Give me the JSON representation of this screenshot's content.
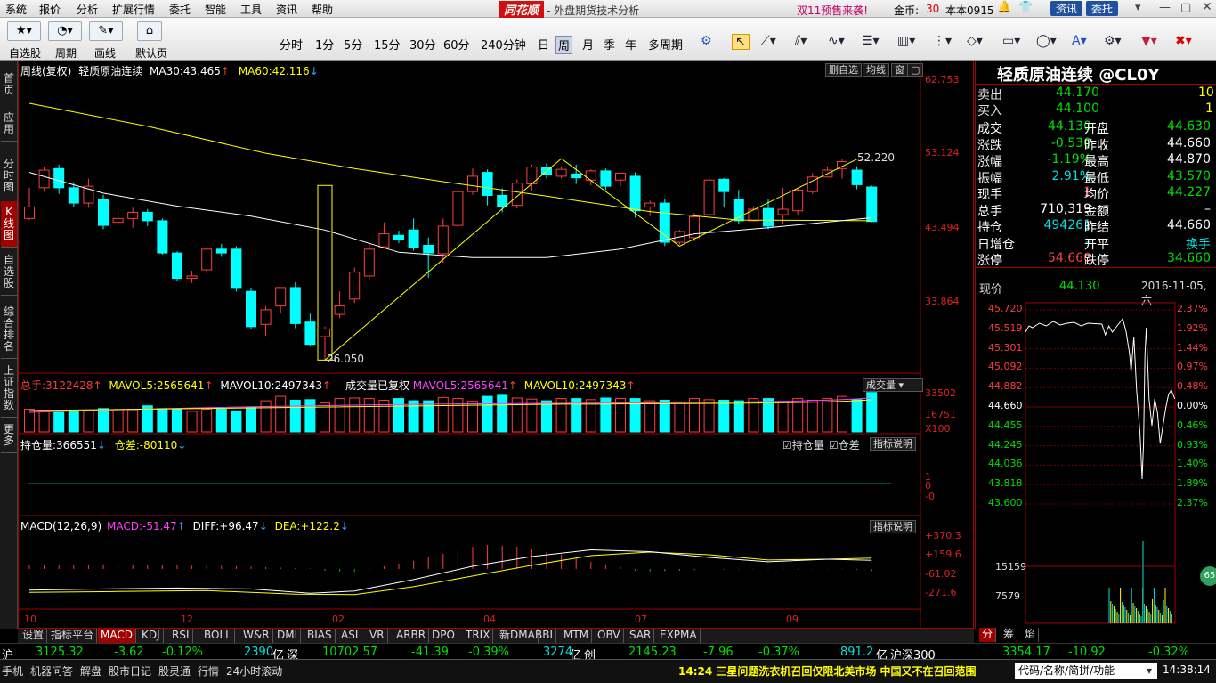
{
  "menu": [
    "系统",
    "报价",
    "分析",
    "扩展行情",
    "委托",
    "智能",
    "工具",
    "资讯",
    "帮助"
  ],
  "brand": "同花顺",
  "app_title": "- 外盘期货技术分析",
  "promo": "双11预售来袭!",
  "coin_label": "金币:",
  "coin_value": "30",
  "user": "本本0915",
  "top_btns": [
    "资讯",
    "委托"
  ],
  "toolbar": {
    "labels": [
      "自选股",
      "周期",
      "画线",
      "默认页"
    ],
    "periods": [
      "分时",
      "1分",
      "5分",
      "15分",
      "30分",
      "60分",
      "240分钟",
      "日",
      "周",
      "月",
      "季",
      "年",
      "多周期"
    ]
  },
  "leftnav": [
    "首页",
    "应用",
    "分时图",
    "K线图",
    "自选股",
    "综合排名",
    "上证指数",
    "更多"
  ],
  "kline": {
    "header_prefix": "周线(复权)",
    "name": "轻质原油连续",
    "ma30_label": "MA30:",
    "ma30": "43.465",
    "ma60_label": "MA60:",
    "ma60": "42.116",
    "btn_delete": "删自选",
    "btn_ma": "均线",
    "btn_win": "窗",
    "yticks": [
      "62.753",
      "53.124",
      "43.494",
      "33.864"
    ],
    "high_label": "52.220",
    "low_label": "26.050",
    "candles": [
      [
        44.5,
        46.0,
        48.5,
        44.3
      ],
      [
        48.5,
        50.8,
        51.2,
        48.0
      ],
      [
        51.0,
        48.5,
        51.5,
        47.7
      ],
      [
        48.5,
        46.5,
        49.2,
        46.0
      ],
      [
        46.5,
        48.7,
        49.7,
        45.9
      ],
      [
        47.0,
        43.6,
        47.6,
        43.1
      ],
      [
        44.0,
        44.5,
        46.1,
        43.5
      ],
      [
        44.5,
        45.3,
        45.9,
        43.3
      ],
      [
        45.3,
        44.2,
        45.7,
        43.5
      ],
      [
        44.2,
        40.0,
        44.5,
        39.8
      ],
      [
        40.0,
        36.7,
        40.2,
        36.4
      ],
      [
        36.7,
        37.0,
        37.7,
        36.1
      ],
      [
        37.8,
        40.5,
        40.9,
        37.3
      ],
      [
        40.5,
        40.0,
        41.2,
        39.5
      ],
      [
        40.5,
        35.5,
        40.9,
        35.0
      ],
      [
        35.0,
        30.4,
        35.5,
        30.1
      ],
      [
        30.7,
        32.6,
        33.1,
        29.2
      ],
      [
        33.1,
        35.5,
        35.5,
        32.1
      ],
      [
        35.5,
        30.8,
        36.2,
        30.2
      ],
      [
        31.0,
        28.1,
        32.1,
        27.8
      ],
      [
        29.1,
        30.1,
        30.4,
        26.05
      ],
      [
        32.0,
        33.1,
        35.0,
        31.5
      ],
      [
        34.0,
        37.5,
        38.1,
        33.5
      ],
      [
        37.0,
        40.5,
        41.3,
        36.6
      ],
      [
        40.8,
        42.5,
        44.0,
        40.7
      ],
      [
        42.3,
        41.7,
        42.9,
        41.3
      ],
      [
        43.0,
        40.7,
        44.5,
        40.3
      ],
      [
        41.0,
        40.0,
        42.0,
        36.8
      ],
      [
        39.9,
        43.5,
        44.5,
        38.7
      ],
      [
        43.6,
        48.0,
        48.4,
        43.3
      ],
      [
        48.0,
        50.0,
        51.0,
        47.6
      ],
      [
        50.5,
        47.5,
        50.9,
        46.2
      ],
      [
        47.5,
        46.0,
        48.4,
        45.3
      ],
      [
        46.2,
        49.1,
        49.6,
        45.8
      ],
      [
        49.0,
        51.2,
        51.5,
        48.2
      ],
      [
        51.2,
        50.2,
        51.7,
        49.7
      ],
      [
        50.0,
        50.9,
        51.3,
        49.7
      ],
      [
        50.3,
        49.8,
        51.5,
        49.0
      ],
      [
        49.5,
        50.7,
        50.9,
        48.8
      ],
      [
        50.7,
        48.7,
        51.0,
        48.2
      ],
      [
        49.5,
        50.4,
        50.5,
        48.7
      ],
      [
        50.0,
        45.5,
        50.5,
        44.6
      ],
      [
        46.0,
        46.5,
        46.8,
        44.8
      ],
      [
        46.5,
        41.4,
        47.0,
        40.9
      ],
      [
        41.4,
        42.8,
        43.0,
        41.1
      ],
      [
        42.0,
        44.7,
        45.2,
        41.5
      ],
      [
        45.0,
        49.5,
        50.1,
        44.6
      ],
      [
        49.6,
        48.0,
        49.8,
        45.9
      ],
      [
        47.0,
        44.2,
        48.2,
        43.8
      ],
      [
        44.2,
        45.7,
        46.1,
        44.3
      ],
      [
        45.8,
        43.5,
        47.0,
        43.1
      ],
      [
        45.0,
        45.7,
        48.5,
        43.8
      ],
      [
        45.5,
        48.2,
        48.5,
        45.0
      ],
      [
        48.0,
        49.9,
        50.4,
        47.7
      ],
      [
        49.9,
        50.8,
        51.2,
        50.3
      ],
      [
        51.0,
        51.9,
        52.22,
        49.7
      ],
      [
        50.8,
        48.9,
        51.3,
        48.3
      ],
      [
        48.6,
        44.1,
        48.8,
        44.0
      ]
    ],
    "ma30_path": [
      [
        0,
        50.5
      ],
      [
        5,
        47.8
      ],
      [
        10,
        46.1
      ],
      [
        15,
        44.8
      ],
      [
        20,
        43.0
      ],
      [
        25,
        40.1
      ],
      [
        30,
        39.4
      ],
      [
        35,
        39.4
      ],
      [
        40,
        40.5
      ],
      [
        45,
        42.5
      ],
      [
        50,
        43.3
      ],
      [
        57,
        44.6
      ]
    ],
    "ma60_path": [
      [
        0,
        59.5
      ],
      [
        8,
        56.5
      ],
      [
        16,
        53.0
      ],
      [
        22,
        51.0
      ],
      [
        28,
        49.3
      ],
      [
        35,
        47.4
      ],
      [
        42,
        45.4
      ],
      [
        48,
        44.3
      ],
      [
        57,
        44.2
      ]
    ],
    "zigzag": [
      [
        20,
        26.05
      ],
      [
        36,
        52.3
      ],
      [
        44,
        40.9
      ],
      [
        56,
        52.22
      ]
    ]
  },
  "volume": {
    "total_label": "总手:",
    "total": "3122428",
    "mavol5_label": "MAVOL5:",
    "mavol5": "2565641",
    "mavol10_label": "MAVOL10:",
    "mavol10": "2497343",
    "label2": "成交量已复权",
    "mavol5b_label": "MAVOL5:",
    "mavol5b": "2565641",
    "mavol10b_label": "MAVOL10:",
    "mavol10b": "2497343",
    "dropdown": "成交量",
    "yticks": [
      "33502",
      "16751",
      "X100"
    ],
    "values": [
      205,
      195,
      175,
      185,
      195,
      210,
      200,
      200,
      235,
      210,
      205,
      185,
      205,
      205,
      190,
      220,
      280,
      320,
      285,
      290,
      260,
      300,
      305,
      300,
      285,
      300,
      280,
      280,
      310,
      300,
      275,
      320,
      330,
      305,
      295,
      280,
      300,
      300,
      290,
      305,
      300,
      300,
      280,
      285,
      270,
      300,
      290,
      285,
      280,
      300,
      300,
      265,
      300,
      285,
      300,
      320,
      290,
      355
    ]
  },
  "oi": {
    "label": "持仓量:",
    "value": "366551",
    "diff_label": "仓差:",
    "diff": "-80110",
    "chk1": "持仓量",
    "chk2": "仓差",
    "btn": "指标说明",
    "yticks": [
      "1",
      "0",
      "-0"
    ]
  },
  "macd": {
    "label": "MACD(12,26,9)",
    "macd_label": "MACD:",
    "macd": "-51.47",
    "diff_label": "DIFF:",
    "diff": "+96.47",
    "dea_label": "DEA:",
    "dea": "+122.2",
    "btn": "指标说明",
    "yticks": [
      "+370.3",
      "+159.6",
      "-61.02",
      "-271.6"
    ],
    "diff_path": [
      [
        0,
        -240
      ],
      [
        5,
        -225
      ],
      [
        10,
        -215
      ],
      [
        15,
        -225
      ],
      [
        19,
        -275
      ],
      [
        22,
        -250
      ],
      [
        26,
        -120
      ],
      [
        30,
        30
      ],
      [
        34,
        140
      ],
      [
        38,
        215
      ],
      [
        42,
        195
      ],
      [
        46,
        130
      ],
      [
        50,
        80
      ],
      [
        54,
        110
      ],
      [
        57,
        96
      ]
    ],
    "dea_path": [
      [
        0,
        -265
      ],
      [
        6,
        -255
      ],
      [
        12,
        -245
      ],
      [
        18,
        -285
      ],
      [
        22,
        -290
      ],
      [
        26,
        -200
      ],
      [
        30,
        -80
      ],
      [
        34,
        40
      ],
      [
        38,
        150
      ],
      [
        42,
        190
      ],
      [
        46,
        160
      ],
      [
        50,
        100
      ],
      [
        54,
        110
      ],
      [
        57,
        122
      ]
    ]
  },
  "xaxis": [
    "10",
    "12",
    "02",
    "04",
    "07",
    "09"
  ],
  "bottom_tabs": [
    "设置",
    "指标平台",
    "MACD",
    "KDJ",
    "RSI",
    "BOLL",
    "W&R",
    "DMI",
    "BIAS",
    "ASI",
    "VR",
    "ARBR",
    "DPO",
    "TRIX",
    "新DMA",
    "BBI",
    "MTM",
    "OBV",
    "SAR",
    "EXPMA"
  ],
  "quote": {
    "title": "轻质原油连续 @CL0Y",
    "sell_label": "卖出",
    "sell": "44.170",
    "sell_vol": "10",
    "buy_label": "买入",
    "buy": "44.100",
    "buy_vol": "1",
    "rows": [
      [
        "成交",
        "44.130",
        "开盘",
        "44.630"
      ],
      [
        "涨跌",
        "-0.530",
        "昨收",
        "44.660"
      ],
      [
        "涨幅",
        "-1.19%",
        "最高",
        "44.870"
      ],
      [
        "振幅",
        "2.91%",
        "最低",
        "43.570"
      ],
      [
        "现手",
        "1",
        "均价",
        "44.227"
      ],
      [
        "总手",
        "710,319",
        "金额",
        "–"
      ],
      [
        "持仓",
        "494261",
        "昨结",
        "44.660"
      ],
      [
        "日增仓",
        "–",
        "开平",
        "换手"
      ],
      [
        "涨停",
        "54.660",
        "跌停",
        "34.660"
      ]
    ],
    "price_label": "现价",
    "price": "44.130",
    "date": "2016-11-05,六"
  },
  "minute": {
    "yleft": [
      "45.720",
      "45.519",
      "45.301",
      "45.092",
      "44.882",
      "44.660",
      "44.455",
      "44.245",
      "44.036",
      "43.818",
      "43.600"
    ],
    "yright": [
      "2.37%",
      "1.92%",
      "1.44%",
      "0.97%",
      "0.48%",
      "0.00%",
      "0.46%",
      "0.93%",
      "1.40%",
      "1.89%",
      "2.37%"
    ],
    "vol_ticks": [
      "15159",
      "7579"
    ],
    "badge": "65",
    "tabs": [
      "分",
      "筹",
      "焰"
    ]
  },
  "ticker": {
    "sh_label": "沪",
    "sh": "3125.32",
    "sh_chg": "-3.62",
    "sh_pct": "-0.12%",
    "sh_amt": "2390",
    "unit": "亿",
    "sz_label": "深",
    "sz": "10702.57",
    "sz_chg": "-41.39",
    "sz_pct": "-0.39%",
    "sz_amt": "3274",
    "cy_label": "创",
    "cy": "2145.23",
    "cy_chg": "-7.96",
    "cy_pct": "-0.37%",
    "cy_amt": "891.2",
    "hs_label": "沪深300",
    "hs": "3354.17",
    "hs_chg": "-10.92",
    "hs_pct": "-0.32%"
  },
  "status": {
    "items": [
      "手机",
      "机器问答",
      "解盘",
      "股市日记",
      "股灵通",
      "行情",
      "24小时滚动"
    ],
    "news": "14:24 三星问题洗衣机召回仅限北美市场 中国又不在召回范围",
    "search": "代码/名称/简拼/功能",
    "time": "14:38:14"
  },
  "colors": {
    "up": "#ff3c3c",
    "down": "#00ffff",
    "ma30": "#ffffff",
    "ma60": "#ffff00",
    "zigzag": "#ffff00",
    "diff": "#ffffff",
    "dea": "#ffff00"
  }
}
